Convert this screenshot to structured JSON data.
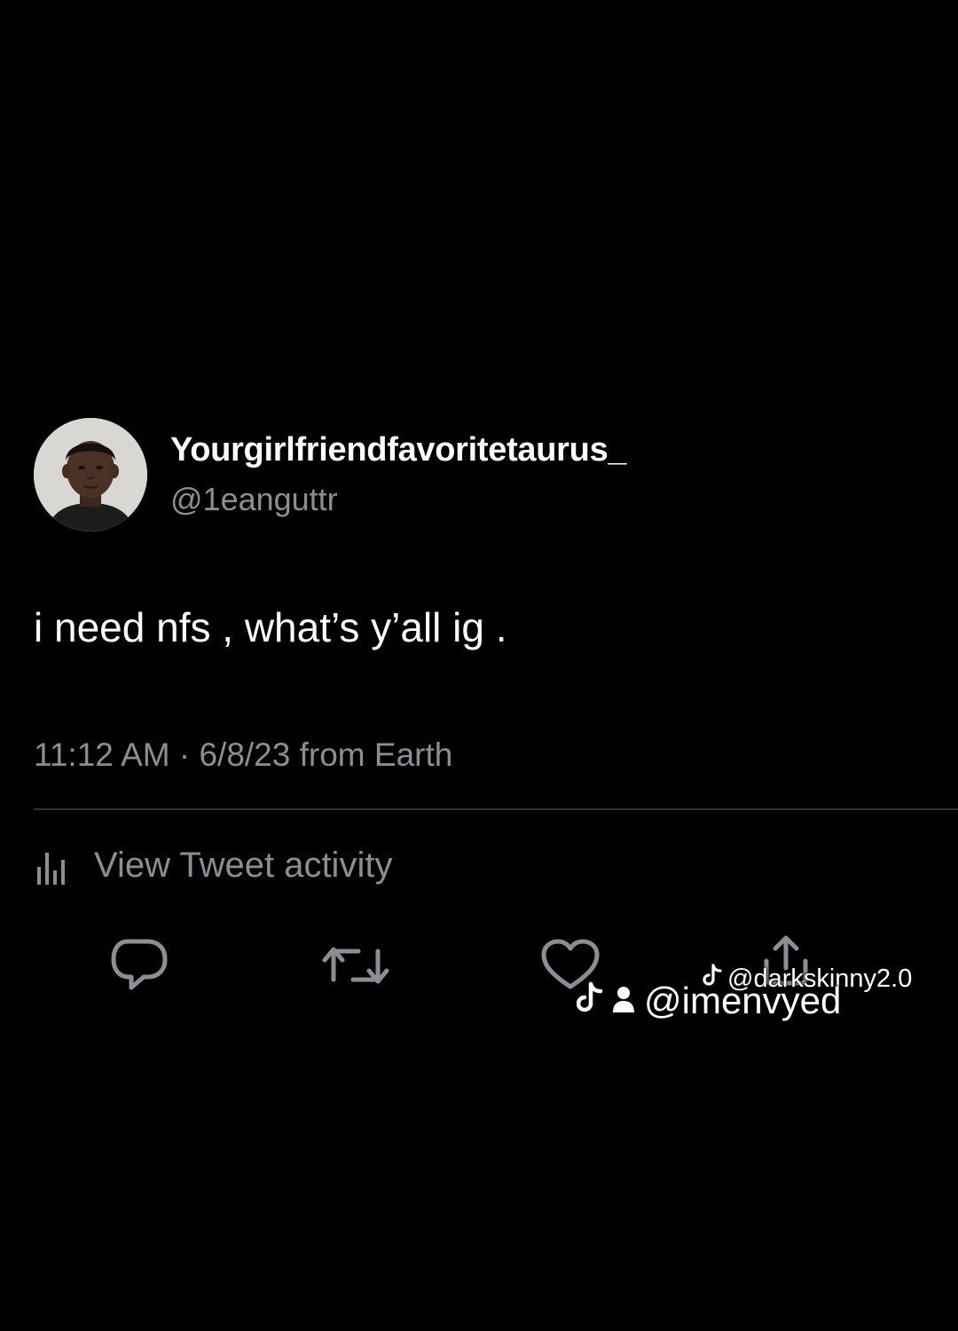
{
  "tweet": {
    "display_name": "Yourgirlfriendfavoritetaurus_",
    "handle": "@1eanguttr",
    "text": "i need nfs , what’s y’all ig .",
    "timestamp": "11:12 AM · 6/8/23 from Earth",
    "activity_label": "View Tweet activity",
    "avatar_icon": "profile-photo",
    "actions": [
      {
        "name": "reply",
        "icon": "speech-bubble-icon"
      },
      {
        "name": "retweet",
        "icon": "retweet-arrows-icon"
      },
      {
        "name": "like",
        "icon": "heart-icon"
      },
      {
        "name": "share",
        "icon": "share-icon"
      }
    ]
  },
  "watermarks": {
    "main": "@imenvyed",
    "secondary": "@darkskinny2.0",
    "icons": [
      "tiktok-icon",
      "person-icon"
    ]
  },
  "colors": {
    "background": "#000000",
    "primary_text": "#ffffff",
    "secondary_text": "#8b8f94",
    "divider": "#2f3336",
    "icon": "#8b8f94"
  }
}
